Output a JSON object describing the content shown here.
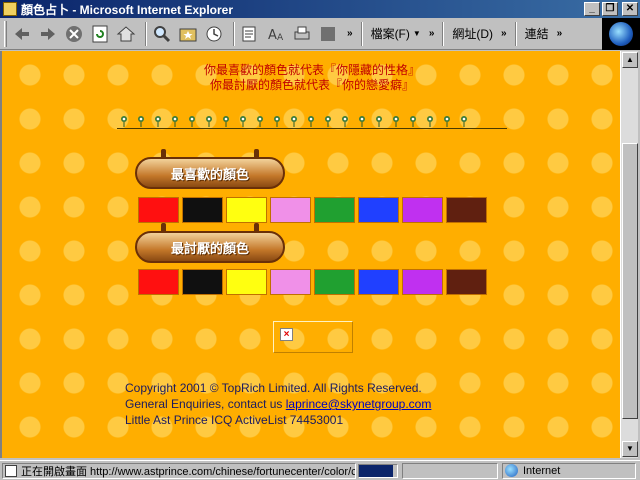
{
  "window": {
    "title": "顏色占卜 - Microsoft Internet Explorer",
    "minimize": "_",
    "restore": "❐",
    "close": "✕"
  },
  "toolbar": {
    "icons": [
      "back-arrow-icon",
      "forward-arrow-icon",
      "stop-icon",
      "refresh-icon",
      "home-icon",
      "search-icon",
      "favorites-icon",
      "history-icon",
      "mail-icon",
      "font-size-icon",
      "print-icon",
      "edit-icon"
    ],
    "chevron": "»",
    "file_menu": "檔案(F)",
    "address_label": "網址(D)",
    "links_label": "連結"
  },
  "page": {
    "fav_line": "你最喜歡的顏色就代表『你隱藏的性格』",
    "hate_line": "你最討厭的顏色就代表『你的戀愛癖』",
    "fav_banner": "最喜歡的顏色",
    "hate_banner": "最討厭的顏色",
    "colors": [
      {
        "name": "red",
        "hex": "#ff1010"
      },
      {
        "name": "black",
        "hex": "#101010"
      },
      {
        "name": "yellow",
        "hex": "#ffff10"
      },
      {
        "name": "pink",
        "hex": "#f090e8"
      },
      {
        "name": "green",
        "hex": "#20a030"
      },
      {
        "name": "blue",
        "hex": "#2040ff"
      },
      {
        "name": "purple",
        "hex": "#c030f0"
      },
      {
        "name": "brown",
        "hex": "#602010"
      }
    ],
    "footer": {
      "copyright": "Copyright 2001 © TopRich Limited. All Rights Reserved.",
      "enquiries_prefix": "General Enquiries, contact us ",
      "email": "laprince@skynetgroup.com",
      "icq": "Little Ast Prince ICQ ActiveList 74453001"
    }
  },
  "status": {
    "text": "正在開啟畫面 http://www.astprince.com/chinese/fortunecenter/color/c",
    "progress_fraction": 0.9,
    "zone": "Internet"
  }
}
